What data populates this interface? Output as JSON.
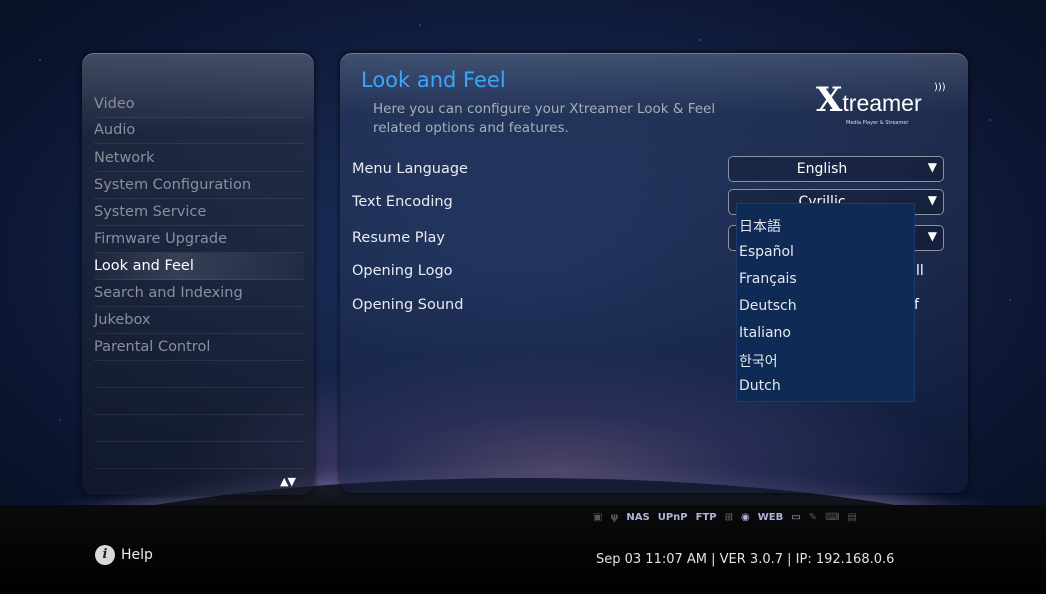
{
  "sidebar": {
    "items": [
      {
        "label": "Video"
      },
      {
        "label": "Audio"
      },
      {
        "label": "Network"
      },
      {
        "label": "System Configuration"
      },
      {
        "label": "System Service"
      },
      {
        "label": "Firmware Upgrade"
      },
      {
        "label": "Look and Feel"
      },
      {
        "label": "Search and Indexing"
      },
      {
        "label": "Jukebox"
      },
      {
        "label": "Parental Control"
      }
    ],
    "active_index": 6,
    "scroll_arrows": "▲▼"
  },
  "panel": {
    "title": "Look and Feel",
    "subtitle": "Here you can configure your Xtreamer Look & Feel related options and features.",
    "logo": {
      "x": "X",
      "text": "treamer",
      "tagline": "Media Player & Streamer"
    }
  },
  "settings": {
    "menu_language": {
      "label": "Menu Language",
      "value": "English"
    },
    "text_encoding": {
      "label": "Text Encoding",
      "value": "Cyrillic"
    },
    "resume_play": {
      "label": "Resume Play"
    },
    "opening_logo": {
      "label": "Opening Logo",
      "partial_value": "ll"
    },
    "opening_sound": {
      "label": "Opening Sound",
      "partial_value": "f"
    }
  },
  "dropdown": {
    "options": [
      "日本語",
      "Español",
      "Français",
      "Deutsch",
      "Italiano",
      "한국어",
      "Dutch"
    ],
    "bg_color": "#0f2b55"
  },
  "status_icons": [
    {
      "name": "nas-icon",
      "label": "NAS"
    },
    {
      "name": "upnp-icon",
      "label": "UPnP"
    },
    {
      "name": "ftp-icon",
      "label": "FTP"
    },
    {
      "name": "web-icon",
      "label": "WEB"
    }
  ],
  "footer": {
    "help": "Help",
    "info": "Sep 03 11:07 AM | VER 3.0.7 | IP: 192.168.0.6"
  },
  "colors": {
    "accent": "#3aa6ff",
    "text": "#e9ebef",
    "dim_text": "#8a8f9c"
  }
}
